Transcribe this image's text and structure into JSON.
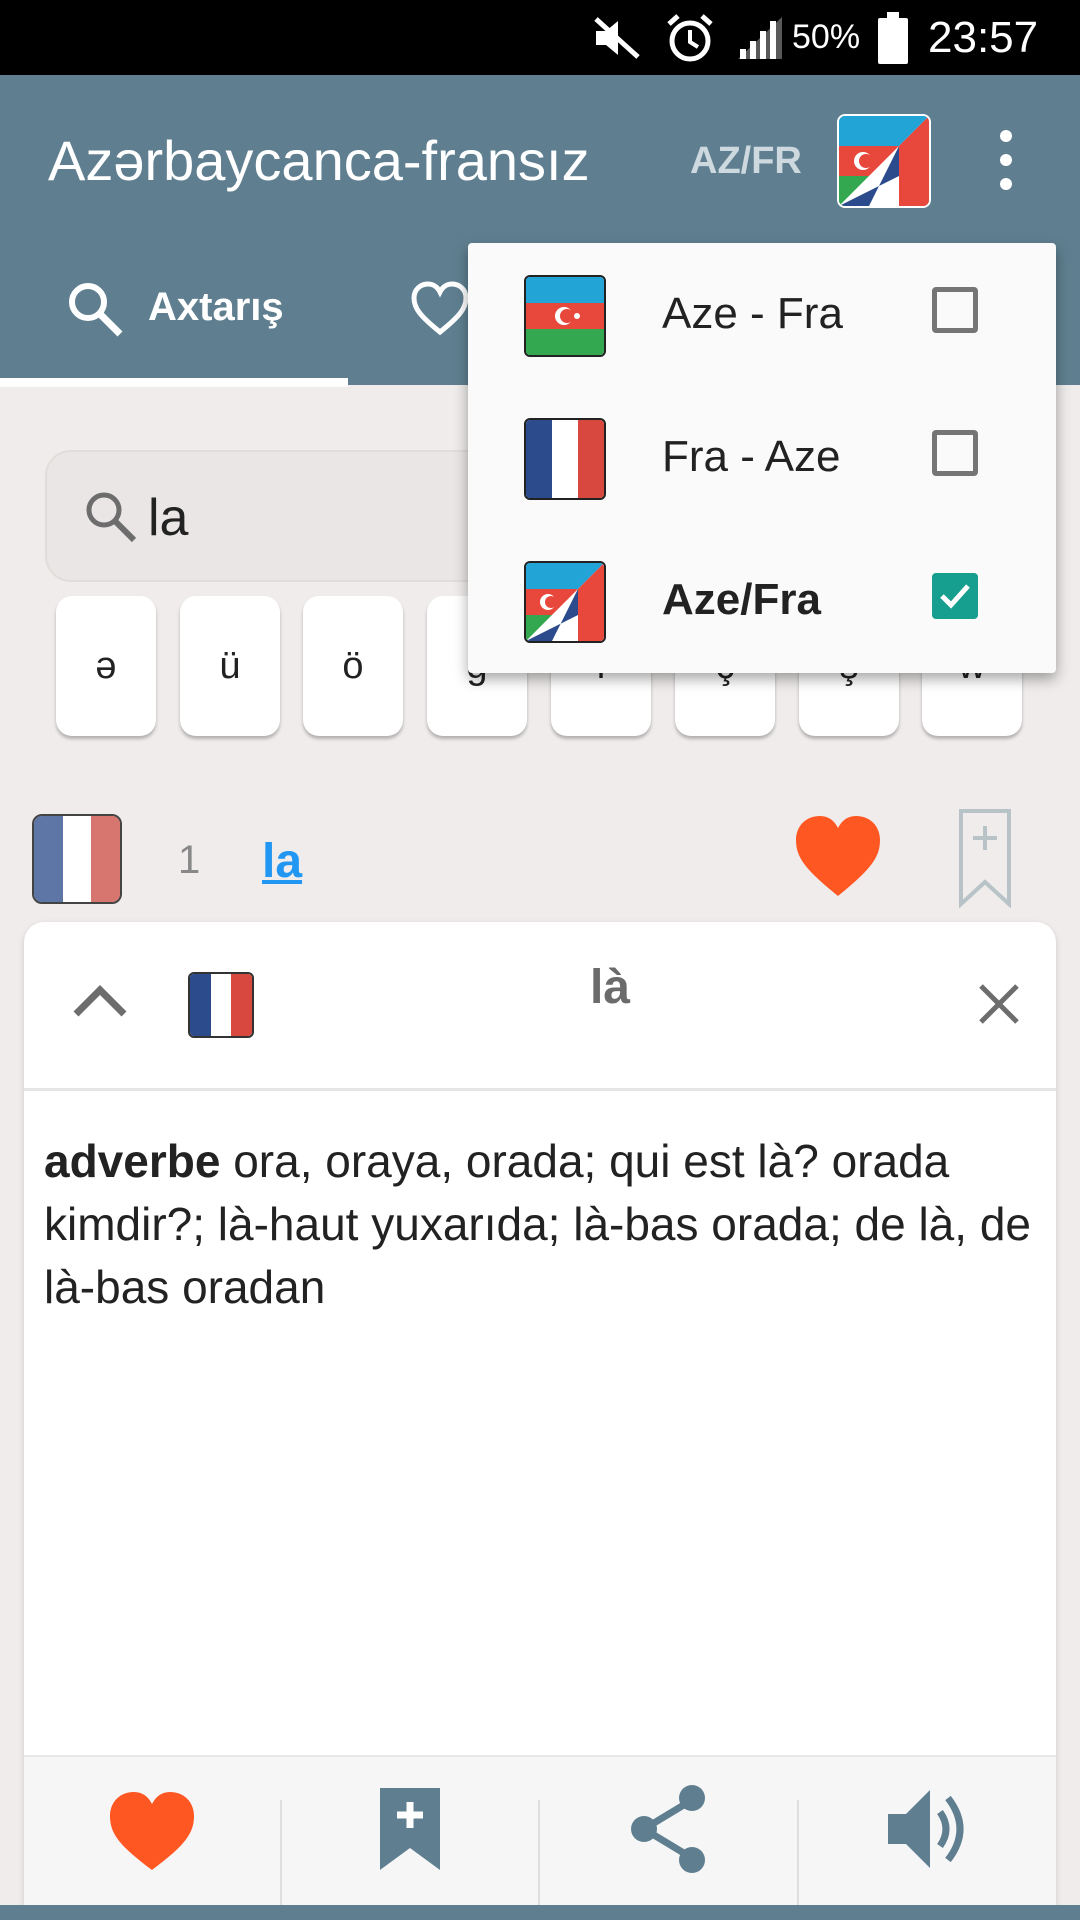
{
  "status_bar": {
    "battery": "50%",
    "time": "23:57"
  },
  "app_bar": {
    "title": "Azərbaycanca-fransız",
    "lang_code": "AZ/FR"
  },
  "tabs": [
    {
      "label": "Axtarış"
    }
  ],
  "search": {
    "query": "la"
  },
  "char_keys": [
    "ə",
    "ü",
    "ö",
    "ğ",
    "ı",
    "ç",
    "ş",
    "w"
  ],
  "result": {
    "index": "1",
    "word": "la"
  },
  "detail": {
    "word": "là",
    "part_of_speech": "adverbe",
    "definition": "ora, oraya, orada; qui est là? orada kimdir?; là-haut yuxarıda; là-bas orada; de là, de là-bas oradan"
  },
  "dropdown": {
    "items": [
      {
        "label": "Aze - Fra",
        "checked": false
      },
      {
        "label": "Fra - Aze",
        "checked": false
      },
      {
        "label": "Aze/Fra",
        "checked": true
      }
    ]
  },
  "colors": {
    "app_bar": "#5f7f90",
    "accent_heart": "#ff5722",
    "link": "#2196f3",
    "checkbox_on": "#169e8e"
  }
}
